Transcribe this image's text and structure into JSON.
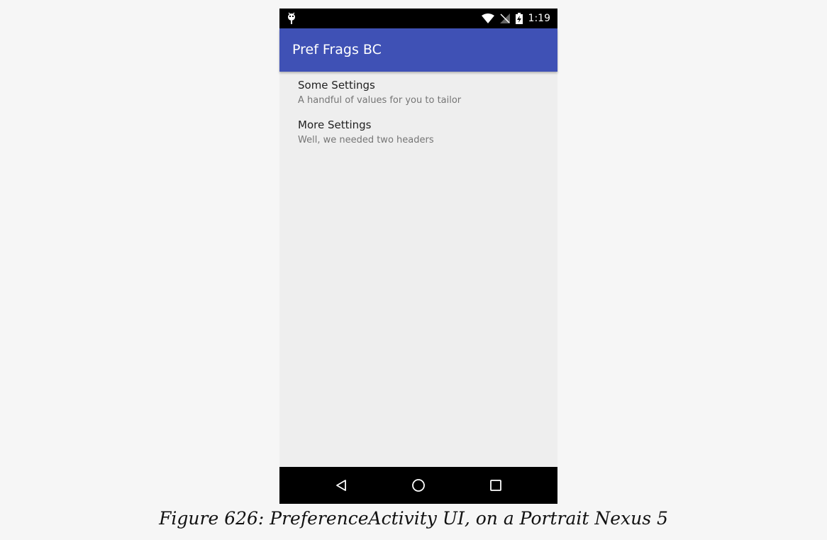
{
  "status_bar": {
    "time": "1:19",
    "icons": [
      "android-notification-icon",
      "wifi-icon",
      "no-signal-icon",
      "battery-charging-icon"
    ]
  },
  "app_bar": {
    "title": "Pref Frags BC",
    "color": "#3f51b5"
  },
  "headers": [
    {
      "title": "Some Settings",
      "summary": "A handful of values for you to tailor"
    },
    {
      "title": "More Settings",
      "summary": "Well, we needed two headers"
    }
  ],
  "nav_bar": {
    "buttons": [
      "back-icon",
      "home-icon",
      "recents-icon"
    ]
  },
  "caption": "Figure 626: PreferenceActivity UI, on a Portrait Nexus 5"
}
